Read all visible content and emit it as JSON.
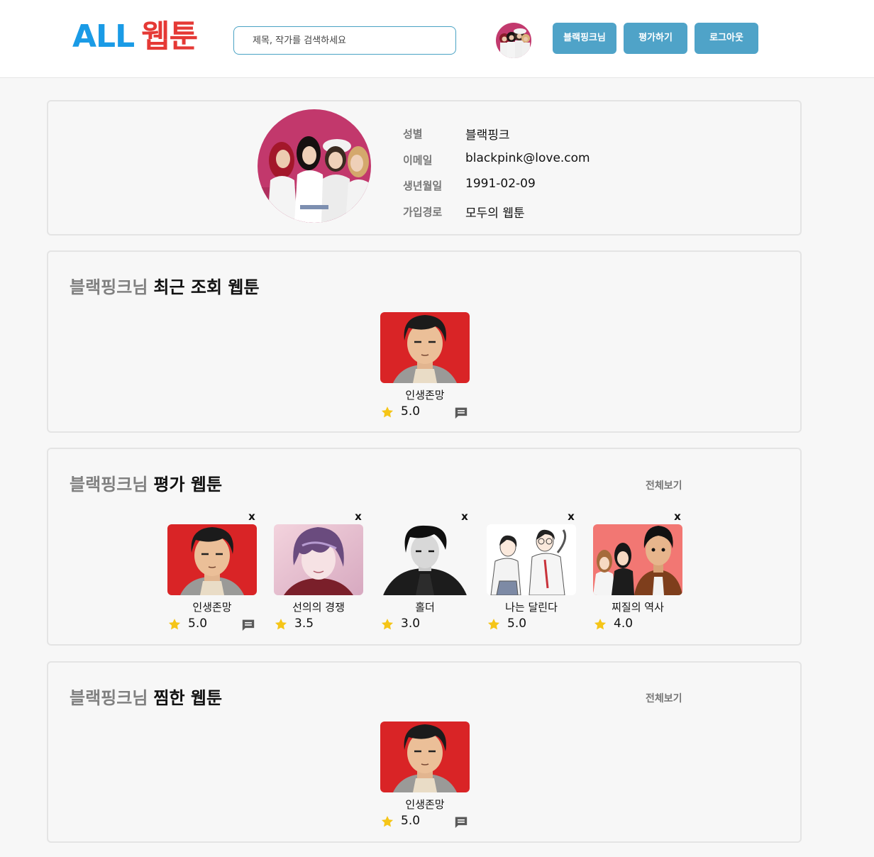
{
  "header": {
    "logo_part1": "ALL",
    "logo_part2": "웹툰",
    "search_placeholder": "제목, 작가를 검색하세요",
    "buttons": {
      "user": "블랙핑크님",
      "rate": "평가하기",
      "logout": "로그아웃"
    }
  },
  "profile": {
    "fields": [
      {
        "label": "성별",
        "value": "블랙핑크"
      },
      {
        "label": "이메일",
        "value": "blackpink@love.com"
      },
      {
        "label": "생년월일",
        "value": "1991-02-09"
      },
      {
        "label": "가입경로",
        "value": "모두의 웹툰"
      }
    ]
  },
  "recent": {
    "user": "블랙핑크님",
    "title": "최근 조회 웹툰",
    "items": [
      {
        "title": "인생존망",
        "rating": "5.0"
      }
    ]
  },
  "rated": {
    "user": "블랙핑크님",
    "title": "평가 웹툰",
    "view_all": "전체보기",
    "close": "x",
    "items": [
      {
        "title": "인생존망",
        "rating": "5.0"
      },
      {
        "title": "선의의 경쟁",
        "rating": "3.5"
      },
      {
        "title": "홀더",
        "rating": "3.0"
      },
      {
        "title": "나는 달린다",
        "rating": "5.0"
      },
      {
        "title": "찌질의 역사",
        "rating": "4.0"
      }
    ]
  },
  "liked": {
    "user": "블랙핑크님",
    "title": "찜한 웹툰",
    "view_all": "전체보기",
    "items": [
      {
        "title": "인생존망",
        "rating": "5.0"
      }
    ]
  },
  "colors": {
    "brand_blue": "#1a9be6",
    "brand_red": "#e53935",
    "button": "#4fa3c8",
    "star": "#f5c518"
  }
}
